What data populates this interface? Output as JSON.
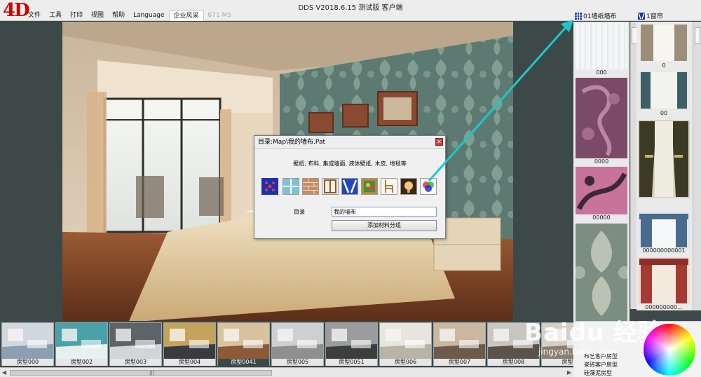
{
  "app": {
    "logo": "4D",
    "title": "DDS V2018.6.15 测试版 客户端"
  },
  "menu": [
    {
      "label": "文件"
    },
    {
      "label": "工具"
    },
    {
      "label": "打印"
    },
    {
      "label": "视图"
    },
    {
      "label": "帮助"
    },
    {
      "label": "Language"
    },
    {
      "label": "企业风采"
    },
    {
      "label": "671 MS"
    }
  ],
  "panels": {
    "wallpaper_tab": "01墙纸墙布",
    "curtain_tab": "1窗帘"
  },
  "swatches": [
    {
      "label": "000"
    },
    {
      "label": "0000"
    },
    {
      "label": "00000"
    },
    {
      "label": ""
    }
  ],
  "curtains": [
    {
      "label": "0"
    },
    {
      "label": "00"
    },
    {
      "label": ""
    },
    {
      "label": "000000000001"
    },
    {
      "label": "000000000..."
    }
  ],
  "filmstrip": [
    {
      "label": "房型000"
    },
    {
      "label": "房型002"
    },
    {
      "label": "房型003"
    },
    {
      "label": "房型004"
    },
    {
      "label": "房型0041"
    },
    {
      "label": "房型005"
    },
    {
      "label": "房型0051"
    },
    {
      "label": "房型006"
    },
    {
      "label": "房型007"
    },
    {
      "label": "房型008"
    },
    {
      "label": "房型"
    }
  ],
  "scrollbar": {
    "grip": "|||"
  },
  "categories": [
    "布艺客户房型",
    "瓷砖客户房型",
    "硅藻泥房型"
  ],
  "dialog": {
    "title": "目录:Map\\我的墙布.Pat",
    "description": "壁纸, 布料, 集成墙面, 液体壁纸, 木皮, 地毯等",
    "icons": [
      "wallpaper-pattern-icon",
      "tile-icon",
      "brick-icon",
      "window-frame-icon",
      "curtain-icon",
      "painting-icon",
      "chair-icon",
      "lamp-icon",
      "rgb-color-icon"
    ],
    "dir_label": "目录",
    "dir_value": "我的墙布",
    "add_button": "添加材料分组"
  },
  "watermark": {
    "brand": "Baidu 经验",
    "url": "jingyan.baidu.com"
  },
  "colors": {
    "background": "#3d4949",
    "accent_arrow": "#1ec8c8",
    "logo_red": "#d40000",
    "selected_icon_border": "#1a33b0"
  }
}
